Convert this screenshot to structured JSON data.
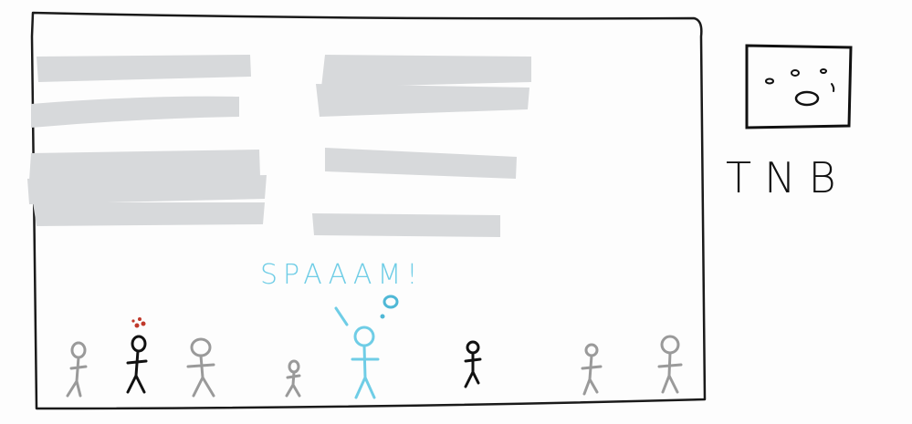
{
  "speech": {
    "text": "SPAAAM!"
  },
  "corner": {
    "text": "TNB"
  },
  "colors": {
    "board_outline": "#1a1a1a",
    "text_placeholder": "#d7d9db",
    "crowd_gray": "#9a9a9a",
    "crowd_black": "#111111",
    "speaker_cyan": "#6fcde6",
    "alarm_red": "#c0392b"
  },
  "icons": [
    "tv-face-icon"
  ]
}
